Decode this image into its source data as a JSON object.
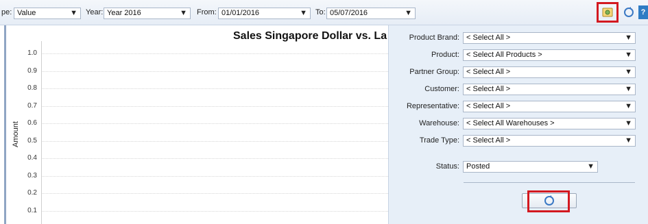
{
  "toolbar": {
    "type_label": "pe:",
    "type_value": "Value",
    "year_label": "Year:",
    "year_value": "Year 2016",
    "from_label": "From:",
    "from_value": "01/01/2016",
    "to_label": "To:",
    "to_value": "05/07/2016",
    "icons": [
      "filter-toggle-icon",
      "refresh-icon",
      "help-icon"
    ],
    "help_glyph": "?"
  },
  "chart": {
    "title": "Sales Singapore Dollar vs. La",
    "ylabel": "Amount",
    "yticks": [
      "1.0",
      "0.9",
      "0.8",
      "0.7",
      "0.6",
      "0.5",
      "0.4",
      "0.3",
      "0.2",
      "0.1"
    ]
  },
  "chart_data": {
    "type": "line",
    "title": "Sales Singapore Dollar vs. La",
    "xlabel": "",
    "ylabel": "Amount",
    "ylim": [
      0.1,
      1.0
    ],
    "yticks": [
      1.0,
      0.9,
      0.8,
      0.7,
      0.6,
      0.5,
      0.4,
      0.3,
      0.2,
      0.1
    ],
    "grid": true,
    "series": []
  },
  "filters": {
    "product_brand": {
      "label": "Product Brand:",
      "value": "< Select All >"
    },
    "product": {
      "label": "Product:",
      "value": "< Select All Products >"
    },
    "partner_group": {
      "label": "Partner Group:",
      "value": "< Select All >"
    },
    "customer": {
      "label": "Customer:",
      "value": "< Select All >"
    },
    "representative": {
      "label": "Representative:",
      "value": "< Select All >"
    },
    "warehouse": {
      "label": "Warehouse:",
      "value": "< Select All Warehouses >"
    },
    "trade_type": {
      "label": "Trade Type:",
      "value": "< Select All >"
    },
    "status": {
      "label": "Status:",
      "value": "Posted"
    }
  },
  "colors": {
    "panel_bg": "#e7eff8",
    "highlight": "#d31920",
    "toolbar_bg": "#e6edf6"
  }
}
